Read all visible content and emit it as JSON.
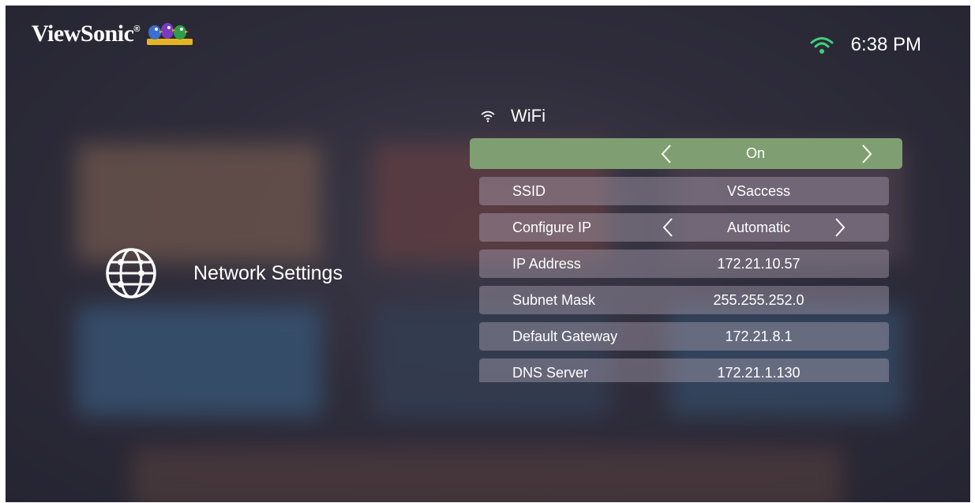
{
  "brand": {
    "name": "ViewSonic",
    "registered_mark": "®"
  },
  "status_bar": {
    "wifi_icon": "wifi-icon",
    "time": "6:38 PM",
    "wifi_color": "#3fd07a"
  },
  "page": {
    "icon": "globe-icon",
    "title": "Network Settings"
  },
  "wifi": {
    "icon": "wifi-icon",
    "label": "WiFi",
    "toggle_value": "On",
    "highlight_color": "#7f9f72"
  },
  "settings": [
    {
      "label": "SSID",
      "value": "VSaccess"
    },
    {
      "label": "Configure IP",
      "value": "Automatic"
    },
    {
      "label": "IP Address",
      "value": "172.21.10.57"
    },
    {
      "label": "Subnet Mask",
      "value": "255.255.252.0"
    },
    {
      "label": "Default Gateway",
      "value": "172.21.8.1"
    },
    {
      "label": "DNS Server",
      "value": "172.21.1.130"
    }
  ]
}
